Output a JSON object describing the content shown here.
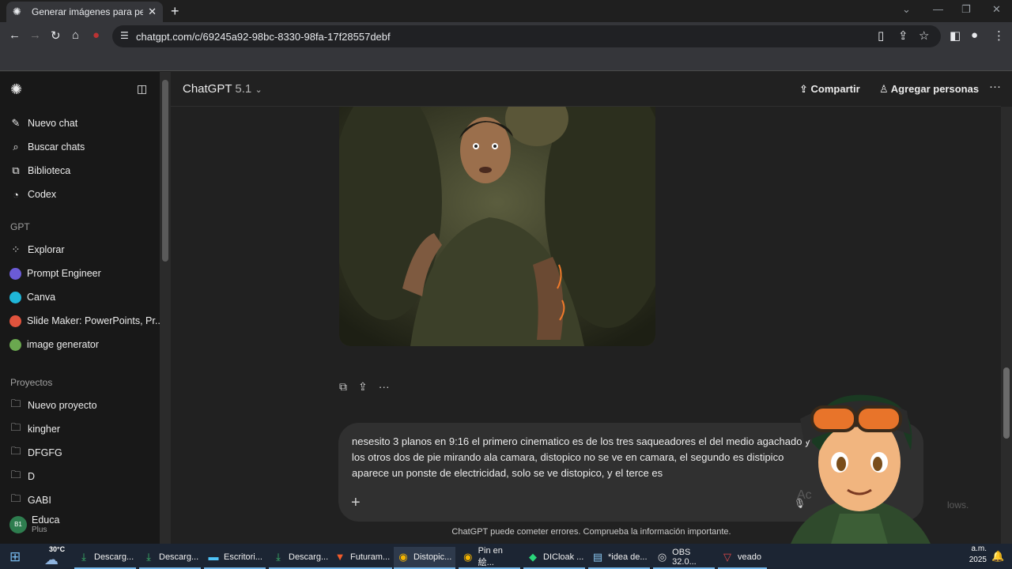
{
  "browser": {
    "tab_title": "Generar imágenes para persona",
    "url": "chatgpt.com/c/69245a92-98bc-8330-98fa-17f28557debf"
  },
  "sidebar": {
    "nav": [
      {
        "label": "Nuevo chat",
        "icon": "edit-icon"
      },
      {
        "label": "Buscar chats",
        "icon": "search-icon"
      },
      {
        "label": "Biblioteca",
        "icon": "library-icon"
      },
      {
        "label": "Codex",
        "icon": "codex-icon"
      }
    ],
    "gpt_heading": "GPT",
    "gpts": [
      {
        "label": "Explorar",
        "icon": "grid-icon"
      },
      {
        "label": "Prompt Engineer",
        "color": "#6b5bd6"
      },
      {
        "label": "Canva",
        "color": "#1fb6d8"
      },
      {
        "label": "Slide Maker: PowerPoints, Pr...",
        "color": "#e0533d"
      },
      {
        "label": "image generator",
        "color": "#6aa84f"
      }
    ],
    "projects_heading": "Proyectos",
    "projects": [
      {
        "label": "Nuevo proyecto",
        "icon": "new-folder-icon"
      },
      {
        "label": "kingher",
        "icon": "folder-icon"
      },
      {
        "label": "DFGFG",
        "icon": "folder-icon"
      },
      {
        "label": "D",
        "icon": "folder-icon"
      },
      {
        "label": "GABI",
        "icon": "folder-icon"
      }
    ],
    "user": {
      "initials": "B1",
      "name": "Educa",
      "plan": "Plus"
    }
  },
  "header": {
    "model": "ChatGPT",
    "version": "5.1",
    "share": "Compartir",
    "add_people": "Agregar personas"
  },
  "composer": {
    "text": "nesesito 3 planos en 9:16 el primero cinematico es de los tres saqueadores el del medio agachado y los otros dos de pie mirando ala camara, distopico no se ve en camara, el segundo es distipico aparece un ponste de electricidad, solo se ve distopico, y el terce es"
  },
  "disclaimer": "ChatGPT puede cometer errores. Comprueba la información importante.",
  "watermark": {
    "line1": "Ac",
    "line2": "lows."
  },
  "taskbar": {
    "temperature": "30°C",
    "items": [
      "Descarg...",
      "Descarg...",
      "Escritori...",
      "Descarg...",
      "Futuram...",
      "Distopic...",
      "Pin en 絵...",
      "DICloak ...",
      "*idea de...",
      "OBS 32.0...",
      "veado"
    ],
    "time": "a.m.",
    "date": "2025"
  }
}
